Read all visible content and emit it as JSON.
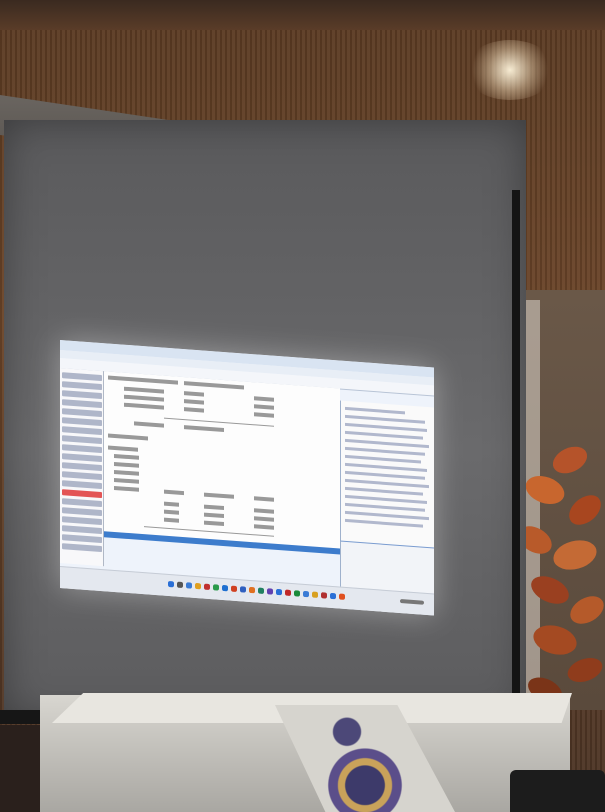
{
  "scene": "projection-screen-in-meeting-room",
  "projected_app": {
    "variables_count": 20,
    "highlighted_variable_index": 13
  },
  "colors": {
    "wall": "#5a3a22",
    "screen": "#5f5f61",
    "projection": "#eef3fb",
    "accent": "#3d7ccc"
  }
}
